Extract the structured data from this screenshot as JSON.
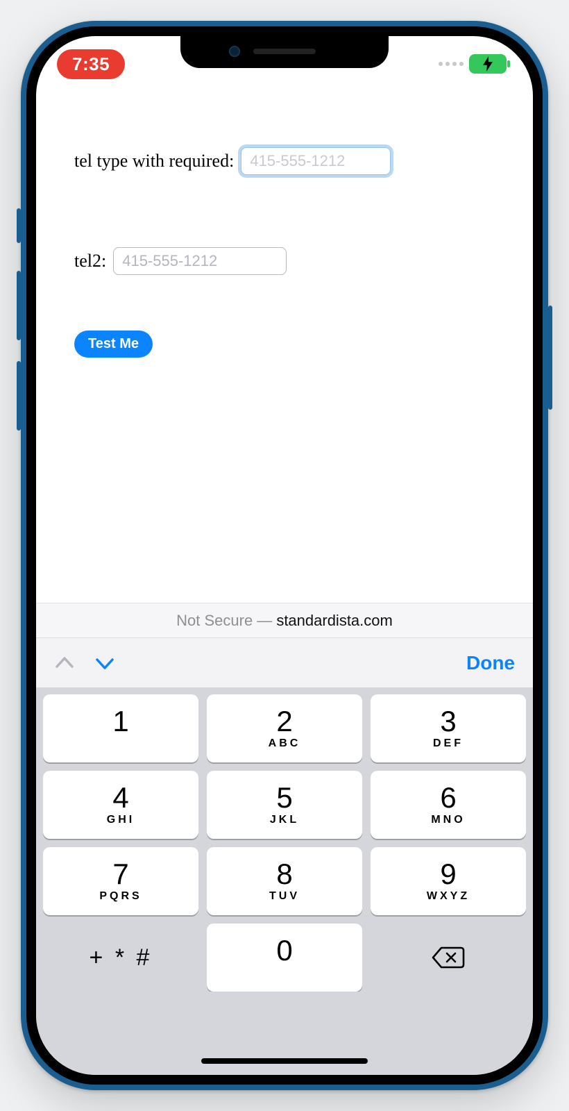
{
  "status": {
    "time": "7:35"
  },
  "page": {
    "field1": {
      "label": "tel type with required: ",
      "placeholder": "415-555-1212",
      "value": ""
    },
    "field2": {
      "label": "tel2: ",
      "placeholder": "415-555-1212",
      "value": ""
    },
    "button": "Test Me"
  },
  "urlbar": {
    "prefix": "Not Secure — ",
    "domain": "standardista.com"
  },
  "kb_accessory": {
    "done": "Done"
  },
  "keypad": {
    "symbols": "+ * #",
    "keys": [
      {
        "d": "1",
        "l": ""
      },
      {
        "d": "2",
        "l": "ABC"
      },
      {
        "d": "3",
        "l": "DEF"
      },
      {
        "d": "4",
        "l": "GHI"
      },
      {
        "d": "5",
        "l": "JKL"
      },
      {
        "d": "6",
        "l": "MNO"
      },
      {
        "d": "7",
        "l": "PQRS"
      },
      {
        "d": "8",
        "l": "TUV"
      },
      {
        "d": "9",
        "l": "WXYZ"
      },
      {
        "d": "0",
        "l": ""
      }
    ]
  }
}
